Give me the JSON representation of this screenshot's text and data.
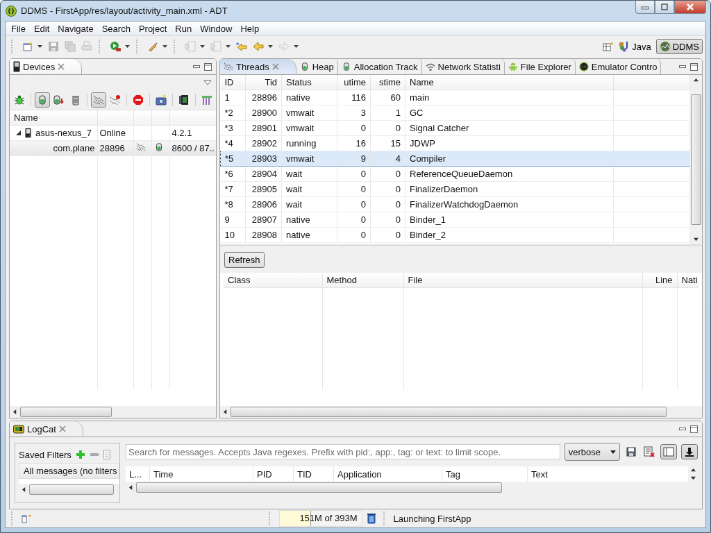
{
  "window": {
    "title": "DDMS - FirstApp/res/layout/activity_main.xml - ADT"
  },
  "menu": [
    "File",
    "Edit",
    "Navigate",
    "Search",
    "Project",
    "Run",
    "Window",
    "Help"
  ],
  "toolbar": [
    [
      {
        "kind": "new",
        "menu": true,
        "disabled": false
      },
      {
        "kind": "save",
        "menu": false,
        "disabled": true
      },
      {
        "kind": "save-all",
        "menu": false,
        "disabled": true
      },
      {
        "kind": "print",
        "menu": false,
        "disabled": true
      }
    ],
    [
      {
        "kind": "run",
        "menu": true,
        "disabled": false
      }
    ],
    [
      {
        "kind": "brush",
        "menu": true,
        "disabled": false
      }
    ],
    [
      {
        "kind": "next-annotation",
        "menu": true,
        "disabled": true
      },
      {
        "kind": "prev-annotation",
        "menu": true,
        "disabled": true
      },
      {
        "kind": "last-edit",
        "menu": false,
        "disabled": false
      },
      {
        "kind": "back",
        "menu": true,
        "disabled": false
      },
      {
        "kind": "forward",
        "menu": true,
        "disabled": true
      }
    ]
  ],
  "perspectives": [
    {
      "label": "Java",
      "kind": "java",
      "selected": false
    },
    {
      "label": "DDMS",
      "kind": "ddms",
      "selected": true
    }
  ],
  "devices": {
    "title": "Devices",
    "toolbar": [
      [
        {
          "kind": "debug",
          "pressed": false
        }
      ],
      [
        {
          "kind": "heap",
          "pressed": true
        },
        {
          "kind": "dump-heap",
          "pressed": false
        },
        {
          "kind": "gc",
          "pressed": false
        }
      ],
      [
        {
          "kind": "threads",
          "pressed": true
        },
        {
          "kind": "profiling",
          "pressed": false
        }
      ],
      [
        {
          "kind": "stop",
          "pressed": false
        }
      ],
      [
        {
          "kind": "screenshot",
          "pressed": false
        }
      ],
      [
        {
          "kind": "hierarchy",
          "pressed": false
        }
      ],
      [
        {
          "kind": "systrace",
          "pressed": false
        }
      ]
    ],
    "columns": [
      "Name"
    ],
    "tree": [
      {
        "name": "asus-nexus_7",
        "status": "Online",
        "version": "4.2.1",
        "expanded": true,
        "children": [
          {
            "name": "com.plane",
            "pid": "28896",
            "threads": true,
            "heap": true,
            "ports": "8600 / 87..",
            "selected": true
          }
        ]
      }
    ]
  },
  "tabs": [
    {
      "label": "Threads",
      "kind": "threads",
      "selected": true
    },
    {
      "label": "Heap",
      "kind": "heap",
      "selected": false
    },
    {
      "label": "Allocation Track",
      "kind": "heap",
      "selected": false
    },
    {
      "label": "Network Statisti",
      "kind": "wifi",
      "selected": false
    },
    {
      "label": "File Explorer",
      "kind": "android",
      "selected": false
    },
    {
      "label": "Emulator Contro",
      "kind": "emulator",
      "selected": false
    }
  ],
  "threads": {
    "columns": [
      "ID",
      "Tid",
      "Status",
      "utime",
      "stime",
      "Name"
    ],
    "rows": [
      {
        "id": "1",
        "tid": "28896",
        "status": "native",
        "utime": "116",
        "stime": "60",
        "name": "main",
        "selected": false
      },
      {
        "id": "*2",
        "tid": "28900",
        "status": "vmwait",
        "utime": "3",
        "stime": "1",
        "name": "GC",
        "selected": false
      },
      {
        "id": "*3",
        "tid": "28901",
        "status": "vmwait",
        "utime": "0",
        "stime": "0",
        "name": "Signal Catcher",
        "selected": false
      },
      {
        "id": "*4",
        "tid": "28902",
        "status": "running",
        "utime": "16",
        "stime": "15",
        "name": "JDWP",
        "selected": false
      },
      {
        "id": "*5",
        "tid": "28903",
        "status": "vmwait",
        "utime": "9",
        "stime": "4",
        "name": "Compiler",
        "selected": true
      },
      {
        "id": "*6",
        "tid": "28904",
        "status": "wait",
        "utime": "0",
        "stime": "0",
        "name": "ReferenceQueueDaemon",
        "selected": false
      },
      {
        "id": "*7",
        "tid": "28905",
        "status": "wait",
        "utime": "0",
        "stime": "0",
        "name": "FinalizerDaemon",
        "selected": false
      },
      {
        "id": "*8",
        "tid": "28906",
        "status": "wait",
        "utime": "0",
        "stime": "0",
        "name": "FinalizerWatchdogDaemon",
        "selected": false
      },
      {
        "id": "9",
        "tid": "28907",
        "status": "native",
        "utime": "0",
        "stime": "0",
        "name": "Binder_1",
        "selected": false
      },
      {
        "id": "10",
        "tid": "28908",
        "status": "native",
        "utime": "0",
        "stime": "0",
        "name": "Binder_2",
        "selected": false
      }
    ],
    "refresh": "Refresh",
    "stack_columns": [
      "Class",
      "Method",
      "File",
      "Line",
      "Nati"
    ]
  },
  "logcat": {
    "title": "LogCat",
    "filters_label": "Saved Filters",
    "filters": [
      {
        "label": "All messages (no filters",
        "selected": true
      }
    ],
    "search_placeholder": "Search for messages. Accepts Java regexes. Prefix with pid:, app:, tag: or text: to limit scope.",
    "level": "verbose",
    "scroll_lock": true,
    "show_filters": true,
    "columns": [
      "L...",
      "Time",
      "PID",
      "TID",
      "Application",
      "Tag",
      "Text"
    ]
  },
  "status_bar": {
    "memory": "151M of 393M",
    "level": 0.38,
    "message": "Launching FirstApp"
  }
}
